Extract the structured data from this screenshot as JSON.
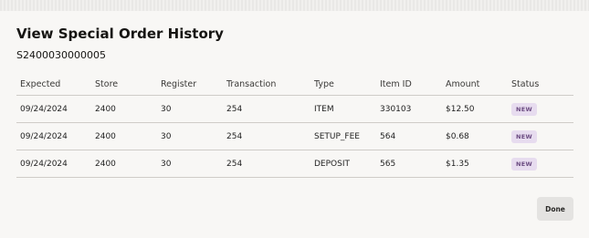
{
  "dialog": {
    "title": "View Special Order History",
    "order_id": "S2400030000005"
  },
  "table": {
    "columns": [
      "Expected",
      "Store",
      "Register",
      "Transaction",
      "Type",
      "Item ID",
      "Amount",
      "Status"
    ],
    "rows": [
      [
        "09/24/2024",
        "2400",
        "30",
        "254",
        "ITEM",
        "330103",
        "$12.50",
        "NEW"
      ],
      [
        "09/24/2024",
        "2400",
        "30",
        "254",
        "SETUP_FEE",
        "564",
        "$0.68",
        "NEW"
      ],
      [
        "09/24/2024",
        "2400",
        "30",
        "254",
        "DEPOSIT",
        "565",
        "$1.35",
        "NEW"
      ]
    ]
  },
  "colors": {
    "status_badge_bg": "#e7dcef",
    "status_badge_text": "#6a4a80"
  },
  "actions": {
    "done_label": "Done"
  }
}
